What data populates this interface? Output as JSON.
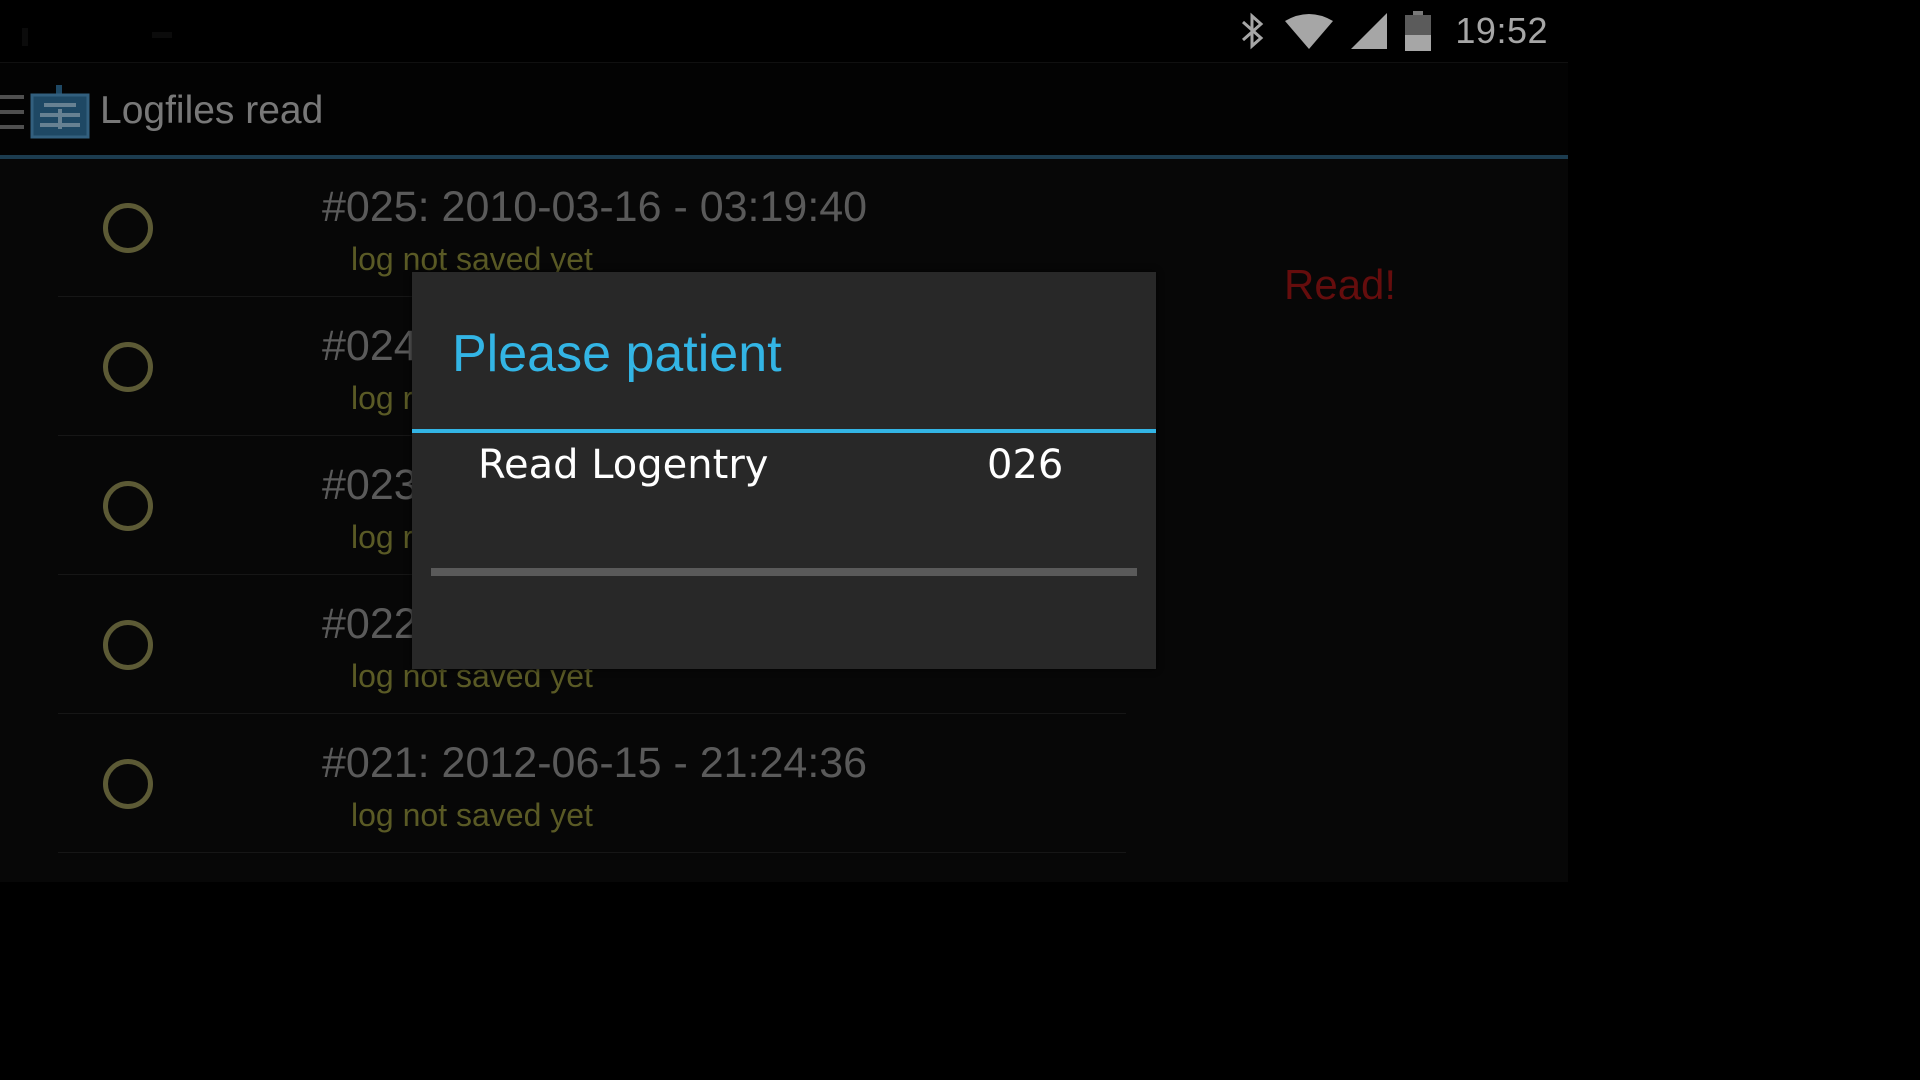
{
  "status_bar": {
    "time": "19:52",
    "icons": [
      "bluetooth-icon",
      "wifi-icon",
      "cell-signal-icon",
      "battery-icon"
    ]
  },
  "action_bar": {
    "title": "Logfiles read",
    "drawer_icon": "menu-icon",
    "app_icon": "logbook-icon"
  },
  "list": {
    "items": [
      {
        "title": "#025: 2010-03-16 - 03:19:40",
        "subtitle": "log not saved yet"
      },
      {
        "title": "#024",
        "subtitle": "log r"
      },
      {
        "title": "#023",
        "subtitle": "log r"
      },
      {
        "title": "#022",
        "subtitle": "log not saved yet"
      },
      {
        "title": "#021: 2012-06-15 - 21:24:36",
        "subtitle": "log not saved yet"
      }
    ],
    "read_label": "Read!"
  },
  "dialog": {
    "title": "Please patient",
    "message": "Read Logentry",
    "counter": "026",
    "progress": 0
  },
  "colors": {
    "accent": "#33b5e5",
    "radio": "#8e8a52",
    "subtitle": "#8a8a3a",
    "read_label": "#9b1414"
  }
}
